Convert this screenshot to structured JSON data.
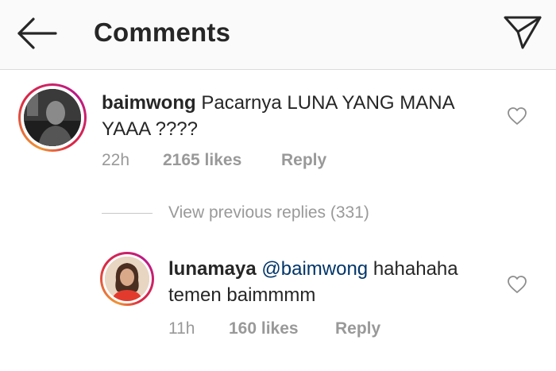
{
  "header": {
    "title": "Comments",
    "back_icon": "arrow-left-icon",
    "share_icon": "direct-send-icon"
  },
  "comments": [
    {
      "username": "baimwong",
      "text": "Pacarnya LUNA YANG MANA YAAA ????",
      "time": "22h",
      "likes": "2165 likes",
      "reply_label": "Reply"
    }
  ],
  "view_replies_label": "View previous replies (331)",
  "reply": {
    "username": "lunamaya",
    "mention": "@baimwong",
    "text": "hahahaha temen baimmmm",
    "time": "11h",
    "likes": "160 likes",
    "reply_label": "Reply"
  },
  "colors": {
    "mention": "#003569",
    "meta": "#999999",
    "text": "#262626",
    "header_bg": "#fafafa"
  }
}
